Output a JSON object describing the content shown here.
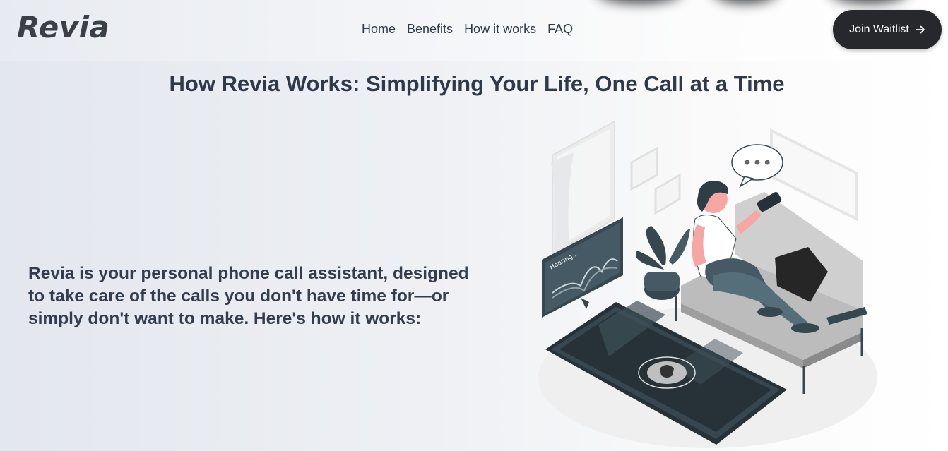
{
  "header": {
    "logo": "Revia",
    "nav": {
      "home": "Home",
      "benefits": "Benefits",
      "how_it_works": "How it works",
      "faq": "FAQ"
    },
    "cta": {
      "label": "Join Waitlist",
      "icon": "arrow-right-icon"
    }
  },
  "section": {
    "title": "How Revia Works: Simplifying Your Life, One Call at a Time",
    "description": "Revia is your personal phone call assistant, designed to take care of the calls you don't have time for—or simply don't want to make. Here's how it works:"
  },
  "illustration": {
    "screen_label": "Hearing...",
    "speech_bubble": "•••"
  },
  "colors": {
    "accent_dark": "#26282c",
    "text": "#2f3a4b",
    "skin": "#f4a7a3",
    "hair": "#2f3e46"
  }
}
